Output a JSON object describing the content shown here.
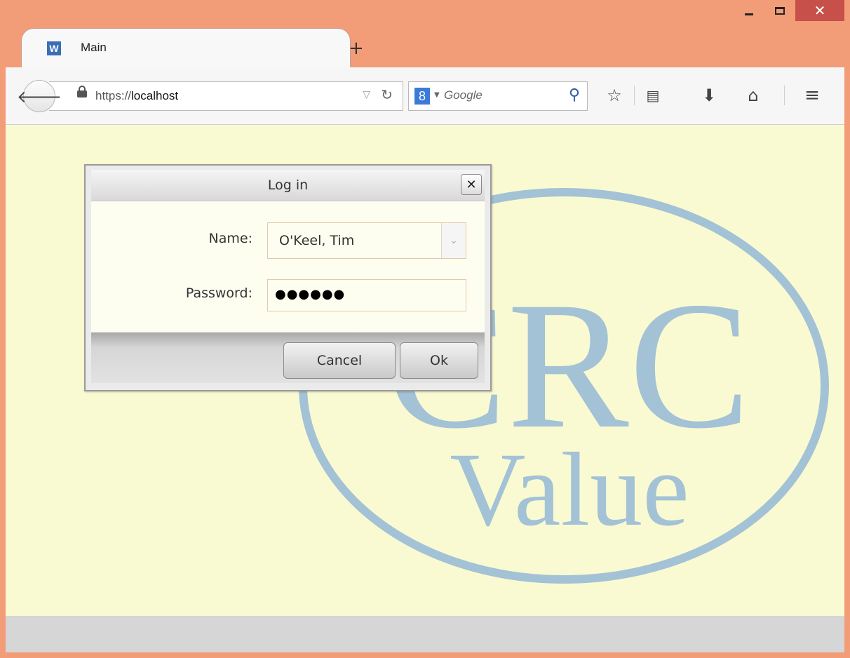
{
  "window": {
    "minimize": "_",
    "maximize": "□",
    "close": "✕"
  },
  "tab": {
    "favicon": "W",
    "title": "Main",
    "new_tab": "+"
  },
  "navbar": {
    "url_scheme": "https://",
    "url_host": "localhost",
    "search_placeholder": "Google",
    "icons": [
      "back-arrow-icon",
      "lock-icon",
      "dropdown-triangle-icon",
      "reload-icon",
      "google-icon",
      "search-icon",
      "bookmark-star-icon",
      "reading-list-icon",
      "download-icon",
      "home-icon",
      "menu-icon"
    ]
  },
  "logo": {
    "line1": "CRC",
    "line2": "Value",
    "color": "#a3c2d6"
  },
  "dialog": {
    "title": "Log in",
    "name_label": "Name:",
    "name_value": "O'Keel, Tim",
    "password_label": "Password:",
    "password_value": "●●●●●●",
    "cancel_label": "Cancel",
    "ok_label": "Ok"
  },
  "colors": {
    "frame": "#f39c78",
    "page_bg": "#fafad2",
    "close_btn": "#c7504a"
  }
}
